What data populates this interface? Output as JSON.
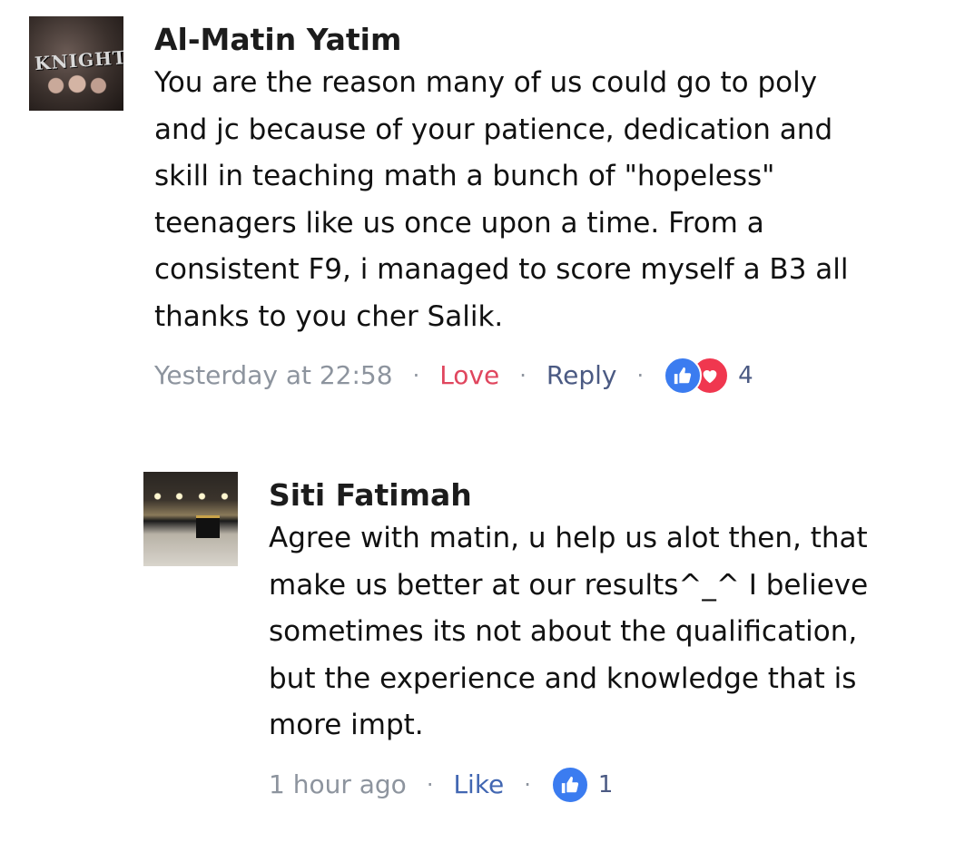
{
  "comments": [
    {
      "author": "Al-Matin Yatim",
      "avatar_label": "KNIGHTS",
      "text": "You are the reason many of us could go to poly\nand jc because of your patience, dedication and\nskill in teaching math a bunch of \"hopeless\"\nteenagers like us once upon a time. From a\nconsistent F9, i managed to score myself a B3 all\nthanks to you cher Salik.",
      "timestamp": "Yesterday at 22:58",
      "reaction_label": "Love",
      "reply_label": "Reply",
      "reaction_icons": [
        "like-icon",
        "heart-icon"
      ],
      "reaction_count": "4"
    },
    {
      "author": "Siti Fatimah",
      "text": "Agree with matin, u help us alot then, that\nmake us better at our results^_^ I believe\nsometimes its not about the qualification,\nbut the experience and knowledge that is\nmore impt.",
      "timestamp": "1 hour ago",
      "reaction_label": "Like",
      "reaction_icons": [
        "like-icon"
      ],
      "reaction_count": "1"
    }
  ],
  "colors": {
    "meta_gray": "#8d949e",
    "love_red": "#e0465e",
    "like_blue": "#4267b2",
    "reply_navy": "#4b5a83",
    "like_badge": "#3b7cf0",
    "heart_badge": "#f0374f"
  }
}
